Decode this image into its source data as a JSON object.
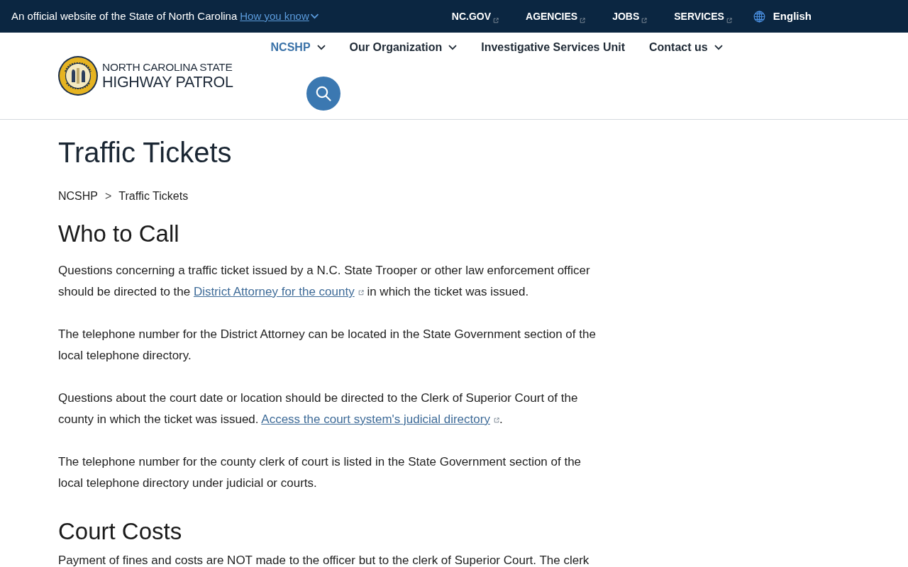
{
  "banner": {
    "text": "An official website of the State of North Carolina",
    "link": "How you know"
  },
  "top_links": [
    {
      "label": "NC.GOV",
      "external": true
    },
    {
      "label": "AGENCIES",
      "external": true
    },
    {
      "label": "JOBS",
      "external": true
    },
    {
      "label": "SERVICES",
      "external": true
    }
  ],
  "language": "English",
  "logo": {
    "line_1": "NORTH CAROLINA STATE",
    "line_2": "HIGHWAY PATROL"
  },
  "main_nav": [
    {
      "label": "NCSHP",
      "selected": true,
      "has_menu": true
    },
    {
      "label": "Our Organization",
      "selected": false,
      "has_menu": true
    },
    {
      "label": "Investigative Services Unit",
      "selected": false,
      "has_menu": false
    },
    {
      "label": "Contact us",
      "selected": false,
      "has_menu": true
    }
  ],
  "page_title": "Traffic Tickets",
  "breadcrumb": {
    "links": [
      "NCSHP"
    ],
    "separator": ">",
    "current": "Traffic Tickets"
  },
  "sections": [
    {
      "heading": "Who to Call",
      "paragraphs": [
        [
          {
            "kind": "text",
            "text": "Questions concerning a traffic ticket issued by a N.C. State Trooper or other law enforcement officer should be directed to the "
          },
          {
            "kind": "link",
            "text": "District Attorney for the county",
            "external": true
          },
          {
            "kind": "text",
            "text": " in which the ticket was issued."
          }
        ],
        [
          {
            "kind": "text",
            "text": "The telephone number for the District Attorney can be located in the State Government section of the local telephone directory."
          }
        ],
        [
          {
            "kind": "text",
            "text": "Questions about the court date or location should be directed to the Clerk of Superior Court of the county in which the ticket was issued. "
          },
          {
            "kind": "link",
            "text": "Access the court system's judicial directory",
            "external": true
          },
          {
            "kind": "text",
            "text": "."
          }
        ],
        [
          {
            "kind": "text",
            "text": "The telephone number for the county clerk of court is listed in the State Government section of the local telephone directory under judicial or courts."
          }
        ]
      ]
    },
    {
      "heading": "Court Costs",
      "paragraphs": [
        [
          {
            "kind": "text",
            "text": "Payment of fines and costs are NOT made to the officer but to the clerk of Superior Court. The clerk"
          }
        ]
      ]
    }
  ]
}
